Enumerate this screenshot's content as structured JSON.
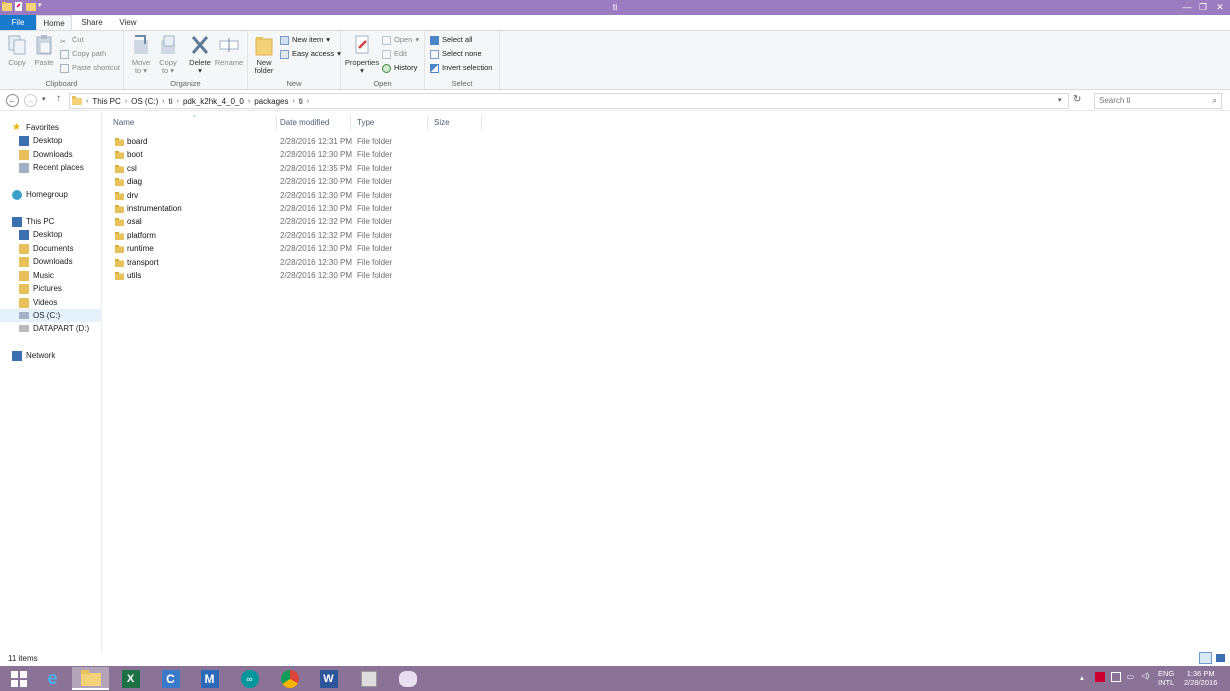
{
  "window": {
    "title": "ti"
  },
  "ribbon_tabs": [
    "File",
    "Home",
    "Share",
    "View"
  ],
  "ribbon": {
    "clipboard": {
      "copy": "Copy",
      "paste": "Paste",
      "cut": "Cut",
      "copy_path": "Copy path",
      "paste_shortcut": "Paste shortcut",
      "label": "Clipboard"
    },
    "organize": {
      "move_to": "Move",
      "move_to2": "to",
      "copy_to": "Copy",
      "copy_to2": "to",
      "delete": "Delete",
      "rename": "Rename",
      "label": "Organize"
    },
    "new": {
      "new_folder": "New",
      "new_folder2": "folder",
      "new_item": "New item",
      "easy_access": "Easy access",
      "label": "New"
    },
    "open": {
      "properties": "Properties",
      "open": "Open",
      "edit": "Edit",
      "history": "History",
      "label": "Open"
    },
    "select": {
      "select_all": "Select all",
      "select_none": "Select none",
      "invert": "Invert selection",
      "label": "Select"
    }
  },
  "address": {
    "crumbs": [
      "This PC",
      "OS (C:)",
      "ti",
      "pdk_k2hk_4_0_0",
      "packages",
      "ti"
    ],
    "search_placeholder": "Search ti"
  },
  "navpane": {
    "favorites": {
      "label": "Favorites",
      "items": [
        "Desktop",
        "Downloads",
        "Recent places"
      ]
    },
    "homegroup": "Homegroup",
    "thispc": {
      "label": "This PC",
      "items": [
        "Desktop",
        "Documents",
        "Downloads",
        "Music",
        "Pictures",
        "Videos",
        "OS (C:)",
        "DATAPART (D:)"
      ]
    },
    "network": "Network"
  },
  "columns": {
    "name": "Name",
    "date": "Date modified",
    "type": "Type",
    "size": "Size"
  },
  "files": [
    {
      "name": "board",
      "date": "2/28/2016 12:31 PM",
      "type": "File folder"
    },
    {
      "name": "boot",
      "date": "2/28/2016 12:30 PM",
      "type": "File folder"
    },
    {
      "name": "csl",
      "date": "2/28/2016 12:35 PM",
      "type": "File folder"
    },
    {
      "name": "diag",
      "date": "2/28/2016 12:30 PM",
      "type": "File folder"
    },
    {
      "name": "drv",
      "date": "2/28/2016 12:30 PM",
      "type": "File folder"
    },
    {
      "name": "instrumentation",
      "date": "2/28/2016 12:30 PM",
      "type": "File folder"
    },
    {
      "name": "osal",
      "date": "2/28/2016 12:32 PM",
      "type": "File folder"
    },
    {
      "name": "platform",
      "date": "2/28/2016 12:32 PM",
      "type": "File folder"
    },
    {
      "name": "runtime",
      "date": "2/28/2016 12:30 PM",
      "type": "File folder"
    },
    {
      "name": "transport",
      "date": "2/28/2016 12:30 PM",
      "type": "File folder"
    },
    {
      "name": "utils",
      "date": "2/28/2016 12:30 PM",
      "type": "File folder"
    }
  ],
  "status": {
    "item_count": "11 items"
  },
  "tray": {
    "lang1": "ENG",
    "lang2": "INTL",
    "time": "1:36 PM",
    "date": "2/28/2016"
  },
  "colors": {
    "titlebar": "#9c7cc0",
    "file_tab": "#1979ca",
    "taskbar": "#8a7396",
    "folder": "#e8c15a"
  }
}
